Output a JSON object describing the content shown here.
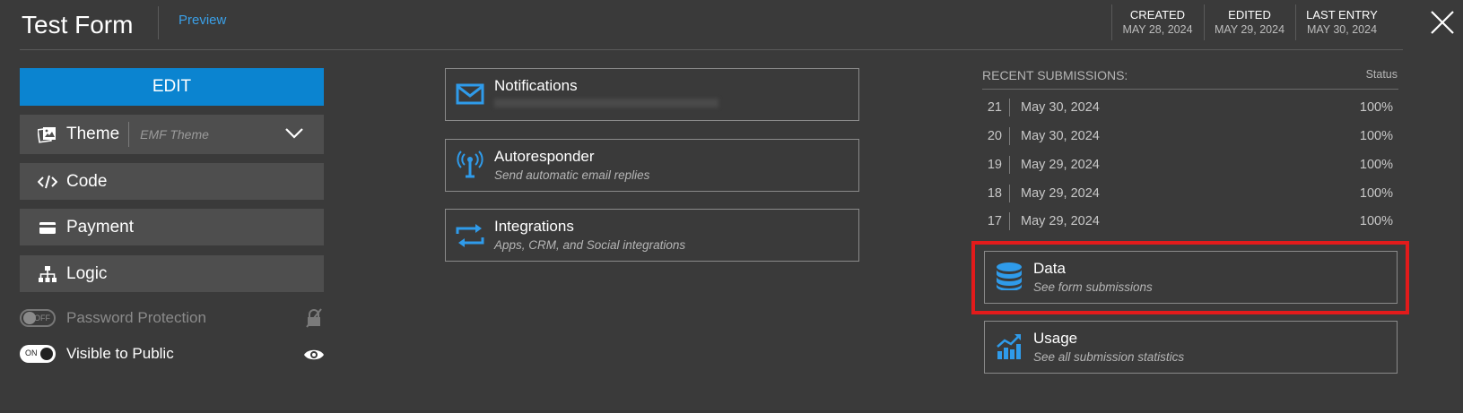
{
  "header": {
    "title": "Test Form",
    "preview_label": "Preview",
    "stats": [
      {
        "label": "CREATED",
        "value": "MAY 28, 2024"
      },
      {
        "label": "EDITED",
        "value": "MAY 29, 2024"
      },
      {
        "label": "LAST ENTRY",
        "value": "MAY 30, 2024"
      }
    ],
    "close_icon": "close-icon"
  },
  "left": {
    "edit_label": "EDIT",
    "theme": {
      "label": "Theme",
      "value": "EMF Theme",
      "icon": "theme-icon"
    },
    "code": {
      "label": "Code",
      "icon": "code-icon"
    },
    "payment": {
      "label": "Payment",
      "icon": "credit-card-icon"
    },
    "logic": {
      "label": "Logic",
      "icon": "sitemap-icon"
    },
    "password": {
      "toggle_text": "OFF",
      "label": "Password Protection",
      "state": false
    },
    "visible": {
      "toggle_text": "ON",
      "label": "Visible to Public",
      "state": true
    }
  },
  "middle": {
    "cards": [
      {
        "title": "Notifications",
        "subtitle": "",
        "icon": "envelope-icon"
      },
      {
        "title": "Autoresponder",
        "subtitle": "Send automatic email replies",
        "icon": "antenna-icon"
      },
      {
        "title": "Integrations",
        "subtitle": "Apps, CRM, and Social integrations",
        "icon": "exchange-arrows-icon"
      }
    ]
  },
  "right": {
    "recent_label": "RECENT SUBMISSIONS:",
    "status_label": "Status",
    "submissions": [
      {
        "num": "21",
        "date": "May 30, 2024",
        "status": "100%"
      },
      {
        "num": "20",
        "date": "May 30, 2024",
        "status": "100%"
      },
      {
        "num": "19",
        "date": "May 29, 2024",
        "status": "100%"
      },
      {
        "num": "18",
        "date": "May 29, 2024",
        "status": "100%"
      },
      {
        "num": "17",
        "date": "May 29, 2024",
        "status": "100%"
      }
    ],
    "data_card": {
      "title": "Data",
      "subtitle": "See form submissions",
      "icon": "database-icon"
    },
    "usage_card": {
      "title": "Usage",
      "subtitle": "See all submission statistics",
      "icon": "chart-growth-icon"
    }
  },
  "colors": {
    "background": "#3a3a3a",
    "accent": "#0b84d0",
    "link": "#3aa0e8",
    "highlight": "#e21b1b"
  }
}
